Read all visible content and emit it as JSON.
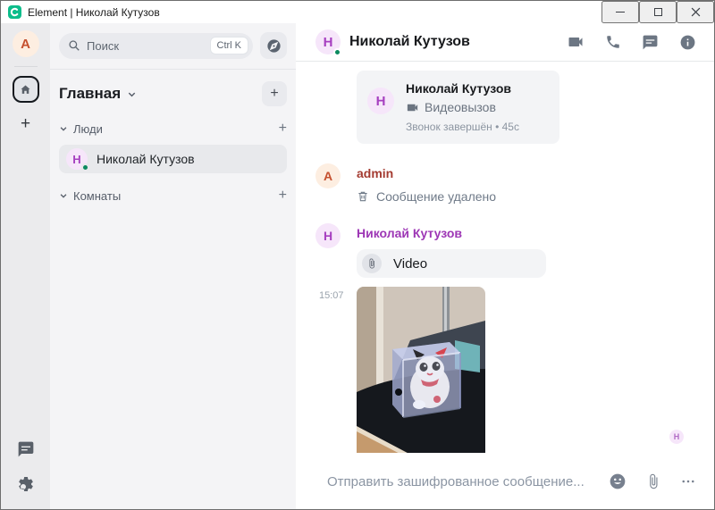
{
  "window": {
    "title": "Element | Николай Кутузов"
  },
  "rail": {
    "user_avatar_letter": "A"
  },
  "sidebar": {
    "search": {
      "placeholder": "Поиск",
      "shortcut": "Ctrl K"
    },
    "space": {
      "label": "Главная"
    },
    "sections": [
      {
        "label": "Люди"
      },
      {
        "label": "Комнаты"
      }
    ],
    "room": {
      "name": "Николай Кутузов",
      "avatar_letter": "Н",
      "online": true
    }
  },
  "chat": {
    "header": {
      "name": "Николай Кутузов",
      "avatar_letter": "Н"
    },
    "call_card": {
      "avatar_letter": "Н",
      "name": "Николай Кутузов",
      "kind": "Видеовызов",
      "status": "Звонок завершён • 45с"
    },
    "deleted_message": {
      "sender": "admin",
      "avatar_letter": "A",
      "text": "Сообщение удалено"
    },
    "media_message": {
      "sender": "Николай Кутузов",
      "avatar_letter": "Н",
      "attachment_label": "Video",
      "time": "15:07",
      "photo_alt": "фигурка белого кота в прозрачном кубе на чёрной поверхности"
    },
    "read_receipt_letter": "Н",
    "composer": {
      "placeholder": "Отправить зашифрованное сообщение..."
    }
  },
  "icons": {
    "logo": "element-logo",
    "titlebar": [
      "minimize-icon",
      "maximize-icon",
      "close-icon"
    ],
    "rail": [
      "home-icon",
      "plus-icon",
      "threads-icon",
      "settings-gear-icon"
    ],
    "sidebar": [
      "search-icon",
      "explore-compass-icon",
      "chevron-down-icon",
      "plus-icon"
    ],
    "chat_header": [
      "video-call-icon",
      "voice-call-icon",
      "threads-icon",
      "info-icon"
    ],
    "timeline": [
      "videocam-icon",
      "trash-icon",
      "paperclip-icon"
    ],
    "composer": [
      "emoji-icon",
      "attach-icon",
      "more-options-icon"
    ]
  },
  "colors": {
    "accent_green": "#0dbd8b",
    "presence_green": "#0c8a5f",
    "sender_purple": "#9d36b5",
    "sender_red": "#a43b31"
  }
}
